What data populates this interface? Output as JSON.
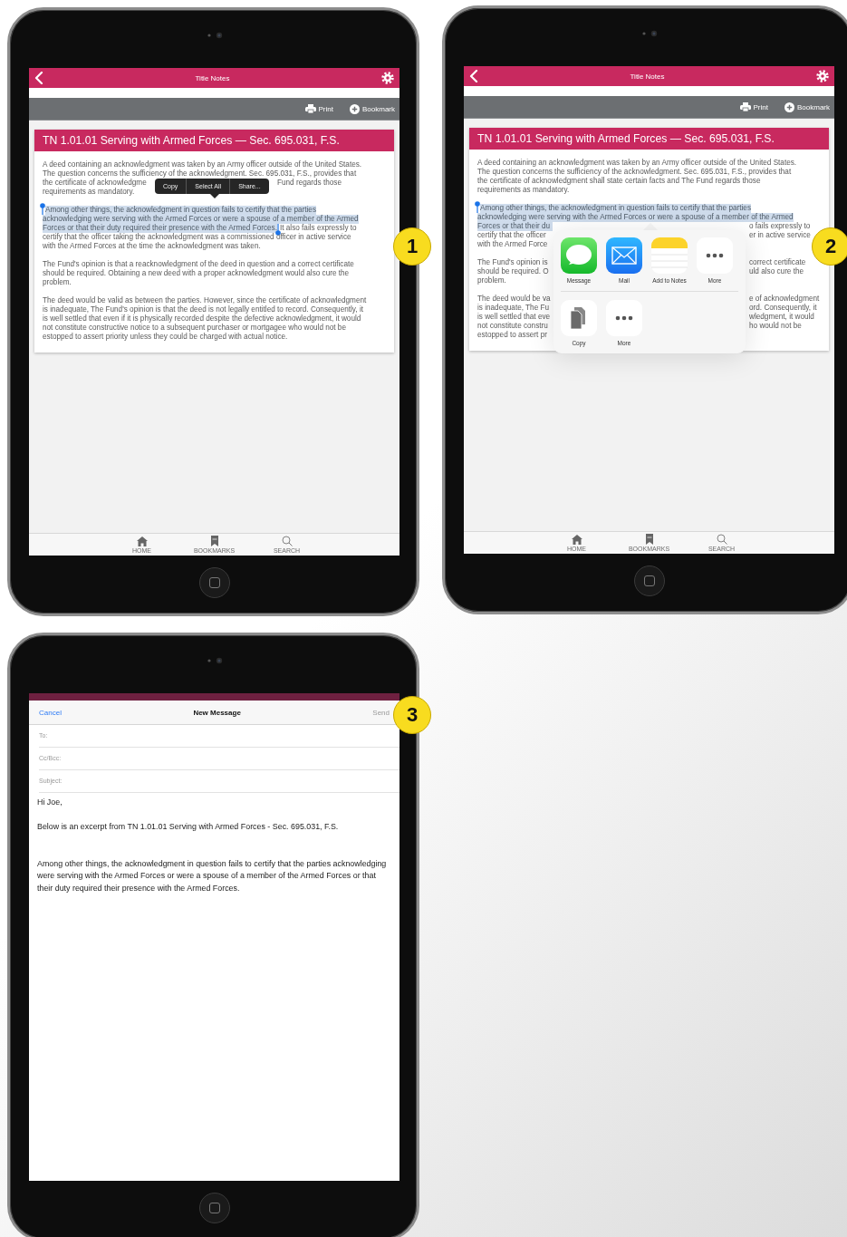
{
  "tablets": [
    {
      "step": "1",
      "kind": "app",
      "screen": {
        "header": {
          "title": "Title Notes"
        },
        "toolbar": [
          {
            "kind": "print",
            "label": "Print"
          },
          {
            "kind": "bookmark",
            "label": "Bookmark"
          }
        ],
        "card": {
          "title": "TN 1.01.01 Serving with Armed Forces — Sec. 695.031, F.S.",
          "paragraphs": [
            {
              "lines": [
                {
                  "kind": "full",
                  "parts": [
                    {
                      "text": "A deed containing an acknowledgment was taken by an Army officer outside of the United States.",
                      "selected": false
                    }
                  ]
                },
                {
                  "kind": "full",
                  "parts": [
                    {
                      "text": "The question concerns the sufficiency of the acknowledgment. Sec. 695.031, F.S., provides that",
                      "selected": false
                    }
                  ]
                },
                {
                  "kind": "split",
                  "parts": [
                    {
                      "text": "the certificate of acknowledgme",
                      "selected": false
                    },
                    {
                      "text": "Fund regards those",
                      "selected": false
                    }
                  ]
                },
                {
                  "kind": "full",
                  "parts": [
                    {
                      "text": "requirements as mandatory.",
                      "selected": false
                    }
                  ]
                }
              ]
            },
            {
              "lines": [
                {
                  "kind": "full",
                  "parts": [
                    {
                      "text": "Among other things, the acknowledgment in question fails to certify that the parties",
                      "selected": true
                    }
                  ]
                },
                {
                  "kind": "full",
                  "parts": [
                    {
                      "text": "acknowledging were serving with the Armed Forces or were a spouse of a member of the Armed",
                      "selected": true
                    }
                  ]
                },
                {
                  "kind": "full",
                  "parts": [
                    {
                      "text": "Forces or that their duty required their presence with the Armed Forces.",
                      "selected": true
                    },
                    {
                      "text": "It also fails expressly to",
                      "selected": false
                    }
                  ]
                },
                {
                  "kind": "full",
                  "parts": [
                    {
                      "text": "certify that the officer taking the acknowledgment was a commissioned officer in active service",
                      "selected": false
                    }
                  ]
                },
                {
                  "kind": "full",
                  "parts": [
                    {
                      "text": "with the Armed Forces at the time the acknowledgment was taken.",
                      "selected": false
                    }
                  ]
                }
              ]
            },
            {
              "lines": [
                {
                  "kind": "full",
                  "parts": [
                    {
                      "text": "The Fund's opinion is that a reacknowledgment of the deed in question and a correct certificate",
                      "selected": false
                    }
                  ]
                },
                {
                  "kind": "full",
                  "parts": [
                    {
                      "text": "should be required. Obtaining a new deed with a proper acknowledgment would also cure the",
                      "selected": false
                    }
                  ]
                },
                {
                  "kind": "full",
                  "parts": [
                    {
                      "text": "problem.",
                      "selected": false
                    }
                  ]
                }
              ]
            },
            {
              "lines": [
                {
                  "kind": "full",
                  "parts": [
                    {
                      "text": "The deed would be valid as between the parties. However, since the certificate of acknowledgment",
                      "selected": false
                    }
                  ]
                },
                {
                  "kind": "full",
                  "parts": [
                    {
                      "text": "is inadequate, The Fund's opinion is that the deed is not legally entitled to record. Consequently, it",
                      "selected": false
                    }
                  ]
                },
                {
                  "kind": "full",
                  "parts": [
                    {
                      "text": "is well settled that even if it is physically recorded despite the defective acknowledgment, it would",
                      "selected": false
                    }
                  ]
                },
                {
                  "kind": "full",
                  "parts": [
                    {
                      "text": "not constitute constructive notice to a subsequent purchaser or mortgagee who would not be",
                      "selected": false
                    }
                  ]
                },
                {
                  "kind": "full",
                  "parts": [
                    {
                      "text": "estopped to assert priority unless they could be charged with actual notice.",
                      "selected": false
                    }
                  ]
                }
              ]
            }
          ]
        },
        "start_handle": true,
        "end_handle": true,
        "edit_menu": [
          "Copy",
          "Select All",
          "Share..."
        ],
        "tab_bar": [
          {
            "kind": "home",
            "label": "HOME"
          },
          {
            "kind": "bookmarks",
            "label": "BOOKMARKS"
          },
          {
            "kind": "search",
            "label": "SEARCH"
          }
        ]
      }
    },
    {
      "step": "2",
      "kind": "app",
      "screen": {
        "header": {
          "title": "Title Notes"
        },
        "toolbar": [
          {
            "kind": "print",
            "label": "Print"
          },
          {
            "kind": "bookmark",
            "label": "Bookmark"
          }
        ],
        "card": {
          "title": "TN 1.01.01 Serving with Armed Forces — Sec. 695.031, F.S.",
          "paragraphs": [
            {
              "lines": [
                {
                  "kind": "full",
                  "parts": [
                    {
                      "text": "A deed containing an acknowledgment was taken by an Army officer outside of the United States.",
                      "selected": false
                    }
                  ]
                },
                {
                  "kind": "full",
                  "parts": [
                    {
                      "text": "The question concerns the sufficiency of the acknowledgment. Sec. 695.031, F.S., provides that",
                      "selected": false
                    }
                  ]
                },
                {
                  "kind": "full",
                  "parts": [
                    {
                      "text": "the certificate of acknowledgment shall state certain facts and The Fund regards those",
                      "selected": false
                    }
                  ]
                },
                {
                  "kind": "full",
                  "parts": [
                    {
                      "text": "requirements as mandatory.",
                      "selected": false
                    }
                  ]
                }
              ]
            },
            {
              "lines": [
                {
                  "kind": "full",
                  "parts": [
                    {
                      "text": "Among other things, the acknowledgment in question fails to certify that the parties",
                      "selected": true
                    }
                  ]
                },
                {
                  "kind": "full",
                  "parts": [
                    {
                      "text": "acknowledging were serving with the Armed Forces or were a spouse of a member of the Armed",
                      "selected": true
                    }
                  ]
                },
                {
                  "kind": "split",
                  "parts": [
                    {
                      "text": "Forces or that their du",
                      "selected": true
                    },
                    {
                      "text": "o fails expressly to",
                      "selected": false
                    }
                  ]
                },
                {
                  "kind": "split",
                  "parts": [
                    {
                      "text": "certify that the officer",
                      "selected": false
                    },
                    {
                      "text": "er in active service",
                      "selected": false
                    }
                  ]
                },
                {
                  "kind": "full",
                  "parts": [
                    {
                      "text": "with the Armed Force",
                      "selected": false
                    }
                  ]
                }
              ]
            },
            {
              "lines": [
                {
                  "kind": "split",
                  "parts": [
                    {
                      "text": "The Fund's opinion is",
                      "selected": false
                    },
                    {
                      "text": "correct certificate",
                      "selected": false
                    }
                  ]
                },
                {
                  "kind": "split",
                  "parts": [
                    {
                      "text": "should be required. O",
                      "selected": false
                    },
                    {
                      "text": "uld also cure the",
                      "selected": false
                    }
                  ]
                },
                {
                  "kind": "full",
                  "parts": [
                    {
                      "text": "problem.",
                      "selected": false
                    }
                  ]
                }
              ]
            },
            {
              "lines": [
                {
                  "kind": "split",
                  "parts": [
                    {
                      "text": "The deed would be va",
                      "selected": false
                    },
                    {
                      "text": "e of acknowledgment",
                      "selected": false
                    }
                  ]
                },
                {
                  "kind": "split",
                  "parts": [
                    {
                      "text": "is inadequate, The Fu",
                      "selected": false
                    },
                    {
                      "text": "ord. Consequently, it",
                      "selected": false
                    }
                  ]
                },
                {
                  "kind": "split",
                  "parts": [
                    {
                      "text": "is well settled that eve",
                      "selected": false
                    },
                    {
                      "text": "wledgment, it would",
                      "selected": false
                    }
                  ]
                },
                {
                  "kind": "split",
                  "parts": [
                    {
                      "text": "not constitute constru",
                      "selected": false
                    },
                    {
                      "text": "ho would not be",
                      "selected": false
                    }
                  ]
                },
                {
                  "kind": "full",
                  "parts": [
                    {
                      "text": "estopped to assert pr",
                      "selected": false
                    }
                  ]
                }
              ]
            }
          ]
        },
        "start_handle": true,
        "share_sheet": {
          "rows": [
            [
              {
                "kind": "message",
                "label": "Message"
              },
              {
                "kind": "mail",
                "label": "Mail"
              },
              {
                "kind": "notes",
                "label": "Add to Notes"
              },
              {
                "kind": "more",
                "label": "More"
              }
            ],
            [
              {
                "kind": "copy",
                "label": "Copy"
              },
              {
                "kind": "more",
                "label": "More"
              }
            ]
          ]
        },
        "tab_bar": [
          {
            "kind": "home",
            "label": "HOME"
          },
          {
            "kind": "bookmarks",
            "label": "BOOKMARKS"
          },
          {
            "kind": "search",
            "label": "SEARCH"
          }
        ]
      }
    },
    {
      "step": "3",
      "kind": "mail",
      "screen": {
        "compose": {
          "cancel": "Cancel",
          "title": "New Message",
          "send": {
            "label": "Send",
            "disabled": true
          },
          "fields": [
            "To:",
            "Cc/Bcc:",
            "Subject:"
          ],
          "greeting": "Hi Joe,",
          "intro": "Below is an excerpt from TN 1.01.01 Serving with Armed Forces - Sec. 695.031, F.S.",
          "excerpt": "Among other things, the acknowledgment in question fails to certify that the parties acknowledging were serving with the Armed Forces or were a spouse of a member of the Armed Forces or that their duty required their presence with the Armed Forces."
        }
      }
    }
  ]
}
